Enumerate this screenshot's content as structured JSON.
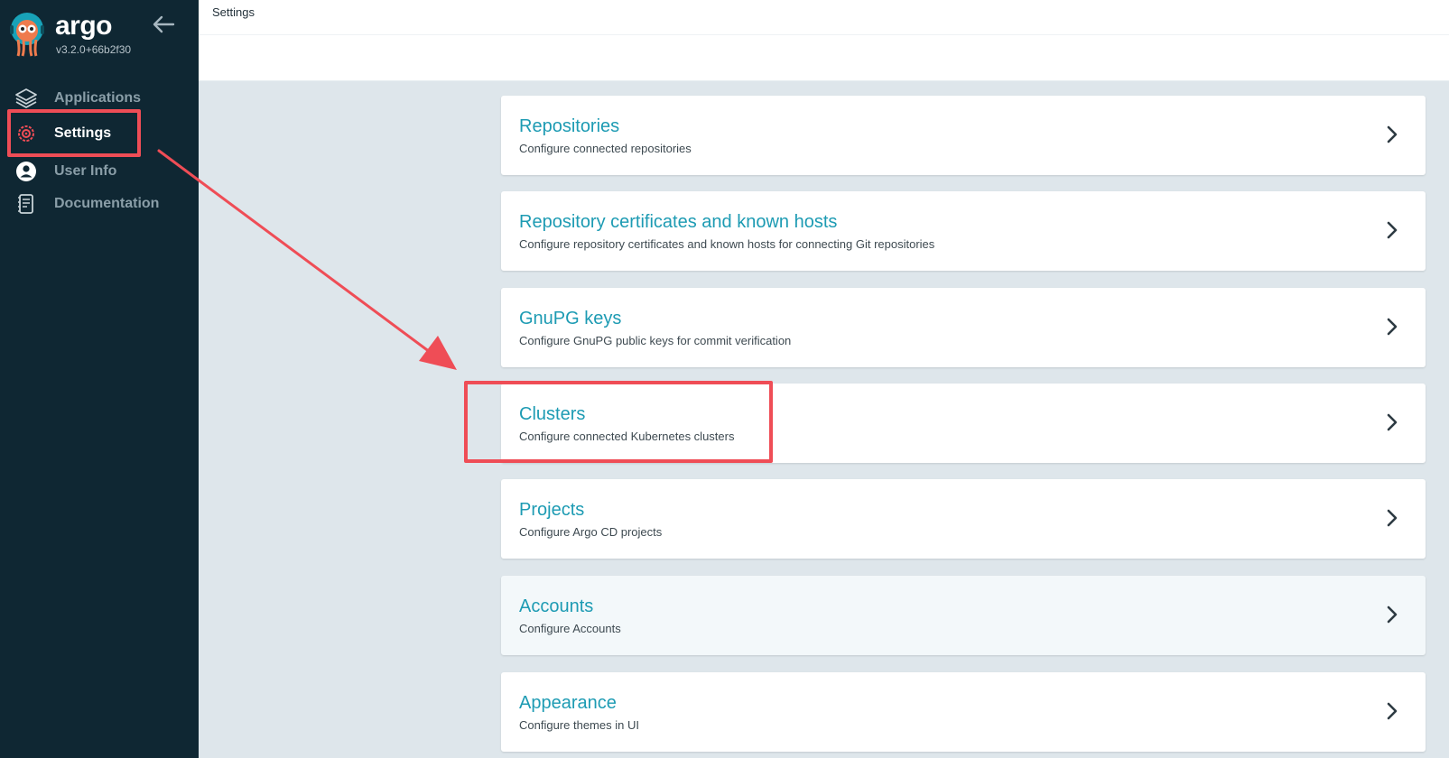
{
  "app": {
    "brand": "argo",
    "version": "v3.2.0+66b2f30"
  },
  "sidebar": {
    "items": [
      {
        "label": "Applications",
        "icon": "layers-icon",
        "active": false
      },
      {
        "label": "Settings",
        "icon": "gear-icon",
        "active": true
      },
      {
        "label": "User Info",
        "icon": "user-icon",
        "active": false
      },
      {
        "label": "Documentation",
        "icon": "book-icon",
        "active": false
      }
    ]
  },
  "header": {
    "breadcrumb": "Settings"
  },
  "settings": [
    {
      "title": "Repositories",
      "description": "Configure connected repositories"
    },
    {
      "title": "Repository certificates and known hosts",
      "description": "Configure repository certificates and known hosts for connecting Git repositories"
    },
    {
      "title": "GnuPG keys",
      "description": "Configure GnuPG public keys for commit verification"
    },
    {
      "title": "Clusters",
      "description": "Configure connected Kubernetes clusters"
    },
    {
      "title": "Projects",
      "description": "Configure Argo CD projects"
    },
    {
      "title": "Accounts",
      "description": "Configure Accounts"
    },
    {
      "title": "Appearance",
      "description": "Configure themes in UI"
    }
  ],
  "colors": {
    "sidebar_bg": "#0f2733",
    "accent": "#1d9bb3",
    "annotation": "#ef4d56",
    "content_bg": "#dee6eb"
  }
}
